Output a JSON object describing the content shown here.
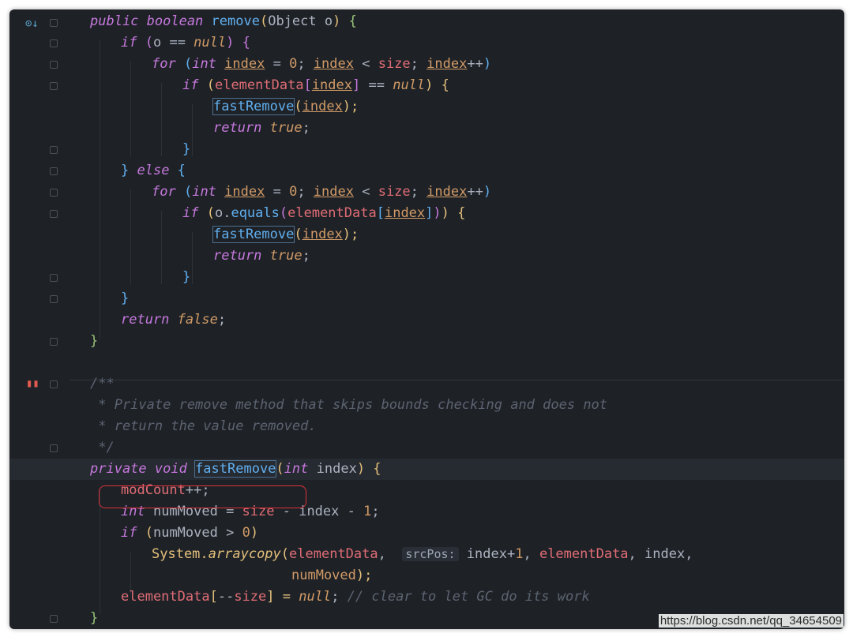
{
  "editor": {
    "theme_colors": {
      "background": "#1e2227",
      "keyword": "#c678dd",
      "function": "#61afef",
      "field": "#e06c75",
      "number": "#d19a66",
      "comment": "#5c6370",
      "highlight_circle": "#d9323a"
    },
    "gutter_icons": [
      "override-method-icon",
      "bookmark-icon"
    ],
    "lines": {
      "l1": {
        "a": "public boolean ",
        "b": "remove",
        "c": "(",
        "d": "Object o",
        "e": ")",
        " f": " {"
      },
      "l2": {
        "a": "if ",
        "b": "(",
        "c": "o ",
        "d": "== ",
        "e": "null",
        "f": ") {"
      },
      "l3": {
        "a": "for ",
        "b": "(",
        "c": "int ",
        "d": "index",
        "e": " = ",
        "f": "0",
        "g": "; ",
        "h": "index",
        "i": " < ",
        "j": "size",
        "k": "; ",
        "l": "index",
        "m": "++",
        "n": ")"
      },
      "l4": {
        "a": "if ",
        "b": "(",
        "c": "elementData",
        "d": "[",
        "e": "index",
        "f": "]",
        "g": " == ",
        "h": "null",
        "i": ") {"
      },
      "l5": {
        "a": "fastRemove",
        "b": "(",
        "c": "index",
        "d": ");"
      },
      "l6": {
        "a": "return ",
        "b": "true",
        "c": ";"
      },
      "l7": {
        "a": "}"
      },
      "l8": {
        "a": "} ",
        "b": "else ",
        "c": "{"
      },
      "l9": {
        "a": "for ",
        "b": "(",
        "c": "int ",
        "d": "index",
        "e": " = ",
        "f": "0",
        "g": "; ",
        "h": "index",
        "i": " < ",
        "j": "size",
        "k": "; ",
        "l": "index",
        "m": "++",
        "n": ")"
      },
      "l10": {
        "a": "if ",
        "b": "(",
        "c": "o.",
        "d": "equals",
        "e": "(",
        "f": "elementData",
        "g": "[",
        "h": "index",
        "i": "]",
        "j": ")",
        "k": ") {"
      },
      "l11": {
        "a": "fastRemove",
        "b": "(",
        "c": "index",
        "d": ");"
      },
      "l12": {
        "a": "return ",
        "b": "true",
        "c": ";"
      },
      "l13": {
        "a": "}"
      },
      "l14": {
        "a": "}"
      },
      "l15": {
        "a": "return ",
        "b": "false",
        "c": ";"
      },
      "l16": {
        "a": "}"
      },
      "l17": {
        "a": "/**"
      },
      "l18": {
        "a": " * Private remove method that skips bounds checking and does not"
      },
      "l19": {
        "a": " * return the value removed."
      },
      "l20": {
        "a": " */"
      },
      "l21": {
        "a": "private void ",
        "b": "fastRemove",
        "c": "(",
        "d": "int ",
        "e": "index",
        "f": ") {"
      },
      "l22": {
        "a": "modCount",
        "b": "++;"
      },
      "l23": {
        "a": "int ",
        "b": "numMoved = ",
        "c": "size",
        "d": " - index - ",
        "e": "1",
        "f": ";"
      },
      "l24": {
        "a": "if ",
        "b": "(",
        "c": "numMoved > ",
        "d": "0",
        "e": ")"
      },
      "l25": {
        "a": "System.",
        "b": "arraycopy",
        "c": "(",
        "d": "elementData",
        "e": ",  ",
        "f": "srcPos:",
        "g": " index+",
        "h": "1",
        "i": ", ",
        "j": "elementData",
        "k": ", index,"
      },
      "l26": {
        "a": "numMoved",
        "b": ");"
      },
      "l27": {
        "a": "elementData",
        "b": "[",
        "c": "--",
        "d": "size",
        "e": "] = ",
        "f": "null",
        "g": "; ",
        "h": "// clear to let GC do its work"
      },
      "l28": {
        "a": "}"
      }
    }
  },
  "watermark": "https://blog.csdn.net/qq_34654509"
}
